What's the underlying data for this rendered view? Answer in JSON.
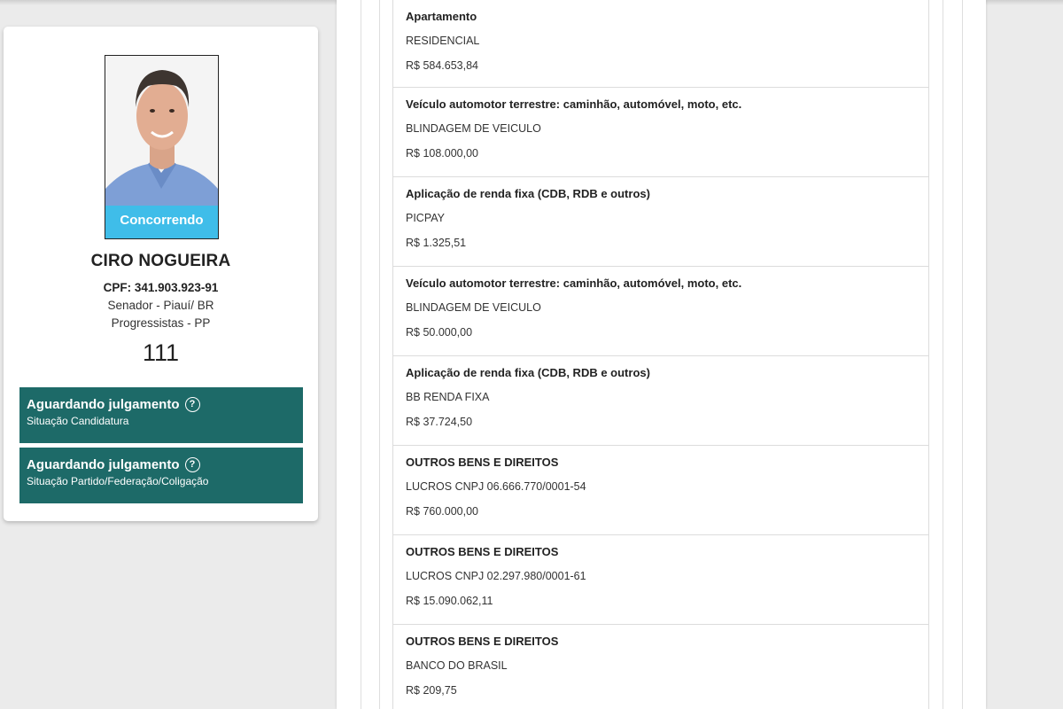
{
  "candidate": {
    "status": "Concorrendo",
    "name": "CIRO NOGUEIRA",
    "cpf": "CPF: 341.903.923-91",
    "office": "Senador - Piauí/ BR",
    "party": "Progressistas - PP",
    "number": "111"
  },
  "situations": [
    {
      "title": "Aguardando julgamento",
      "subtitle": "Situação Candidatura",
      "icon": "question-circle-icon"
    },
    {
      "title": "Aguardando julgamento",
      "subtitle": "Situação Partido/Federação/Coligação",
      "icon": "question-circle-icon"
    }
  ],
  "assets": [
    {
      "type": "Apartamento",
      "description": "RESIDENCIAL",
      "value": "R$ 584.653,84"
    },
    {
      "type": "Veículo automotor terrestre: caminhão, automóvel, moto, etc.",
      "description": "BLINDAGEM DE VEICULO",
      "value": "R$ 108.000,00"
    },
    {
      "type": "Aplicação de renda fixa (CDB, RDB e outros)",
      "description": "PICPAY",
      "value": "R$ 1.325,51"
    },
    {
      "type": "Veículo automotor terrestre: caminhão, automóvel, moto, etc.",
      "description": "BLINDAGEM DE VEICULO",
      "value": "R$ 50.000,00"
    },
    {
      "type": "Aplicação de renda fixa (CDB, RDB e outros)",
      "description": "BB RENDA FIXA",
      "value": "R$ 37.724,50"
    },
    {
      "type": "OUTROS BENS E DIREITOS",
      "description": "LUCROS CNPJ 06.666.770/0001-54",
      "value": "R$ 760.000,00"
    },
    {
      "type": "OUTROS BENS E DIREITOS",
      "description": "LUCROS CNPJ 02.297.980/0001-61",
      "value": "R$ 15.090.062,11"
    },
    {
      "type": "OUTROS BENS E DIREITOS",
      "description": "BANCO DO BRASIL",
      "value": "R$ 209,75"
    }
  ],
  "colors": {
    "status_ribbon": "#3fbde9",
    "situation_bg": "#1d6a68"
  }
}
